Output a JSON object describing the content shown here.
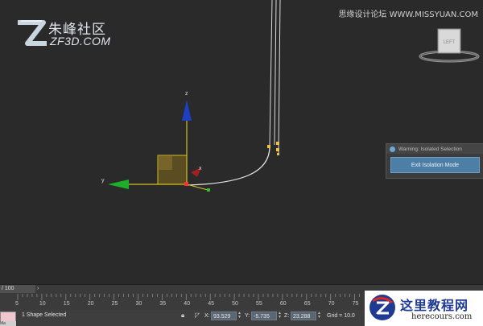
{
  "watermark": {
    "site_cn": "朱峰社区",
    "site_en": "ZF3D.COM",
    "top_right": "思缘设计论坛 WWW.MISSYUAN.COM"
  },
  "viewcube": {
    "face_label": "LEFT"
  },
  "gizmo": {
    "z_label": "z",
    "y_label": "y",
    "x_label": "x"
  },
  "isolation_panel": {
    "title": "Warning: Isolated Selection",
    "button_label": "Exit Isolation Mode"
  },
  "timeline": {
    "frame_display": "/ 100",
    "arrow": "›",
    "ticks": [
      "5",
      "10",
      "15",
      "20",
      "25",
      "30",
      "35",
      "40",
      "45",
      "50",
      "55",
      "60",
      "65",
      "70",
      "75"
    ]
  },
  "status": {
    "selection_text": "1 Shape Selected",
    "x_label": "X:",
    "x_value": "93.529",
    "y_label": "Y:",
    "y_value": "-5.735",
    "z_label": "Z:",
    "z_value": "23.288",
    "grid_text": "Grid = 10.0",
    "bottom_left": "Ma"
  },
  "herecours": {
    "name_cn": "这里教程网",
    "url": "herecours.com"
  },
  "colors": {
    "viewport_bg": "#2a2a2a",
    "gizmo_z": "#1e3fbf",
    "gizmo_y": "#1fae2a",
    "gizmo_x": "#c0392b",
    "spline": "#e8e8e8",
    "vertex": "#f0c040",
    "panel_button": "#4d7fa6"
  }
}
